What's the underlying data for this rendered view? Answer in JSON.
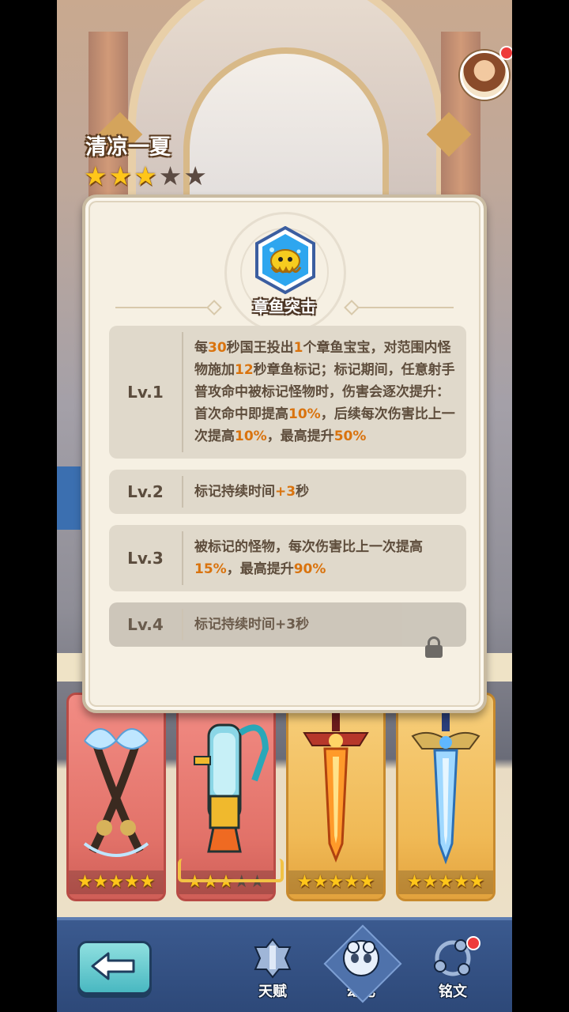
{
  "header": {
    "title": "清凉一夏",
    "stars_filled": 3,
    "stars_total": 5
  },
  "skill": {
    "name": "章鱼突击",
    "icon": "octopus-skill-icon"
  },
  "levels": [
    {
      "label": "Lv.1",
      "parts": [
        {
          "t": "每"
        },
        {
          "t": "30",
          "hl": true
        },
        {
          "t": "秒国王投出"
        },
        {
          "t": "1",
          "hl": true
        },
        {
          "t": "个章鱼宝宝，对范围内怪物施加"
        },
        {
          "t": "12",
          "hl": true
        },
        {
          "t": "秒章鱼标记；标记期间，任意射手普攻命中被标记怪物时，伤害会逐次提升：首次命中即提高"
        },
        {
          "t": "10%",
          "hl": true
        },
        {
          "t": "，后续每次伤害比上一次提高"
        },
        {
          "t": "10%",
          "hl": true
        },
        {
          "t": "，最高提升"
        },
        {
          "t": "50%",
          "hl": true
        }
      ]
    },
    {
      "label": "Lv.2",
      "parts": [
        {
          "t": "标记持续时间"
        },
        {
          "t": "+3",
          "hl": true
        },
        {
          "t": "秒"
        }
      ]
    },
    {
      "label": "Lv.3",
      "parts": [
        {
          "t": "被标记的怪物，每次伤害比上一次提高"
        },
        {
          "t": "15%",
          "hl": true
        },
        {
          "t": "，最高提升"
        },
        {
          "t": "90%",
          "hl": true
        }
      ]
    },
    {
      "label": "Lv.4",
      "locked": true,
      "parts": [
        {
          "t": "标记持续时间+3秒"
        }
      ]
    }
  ],
  "equipment": [
    {
      "name": "dragon-crossed-guns",
      "rarity": "red",
      "stars": 5,
      "selected": false
    },
    {
      "name": "water-gun",
      "rarity": "red",
      "stars": 3,
      "selected": true
    },
    {
      "name": "flame-sword",
      "rarity": "gold",
      "stars": 5,
      "selected": false
    },
    {
      "name": "ice-sword",
      "rarity": "gold",
      "stars": 5,
      "selected": false
    }
  ],
  "nav": {
    "tabs": [
      {
        "label": "天赋",
        "icon": "talent-icon",
        "active": false,
        "badge": false
      },
      {
        "label": "幻化",
        "icon": "transform-icon",
        "active": true,
        "badge": false
      },
      {
        "label": "铭文",
        "icon": "inscription-icon",
        "active": false,
        "badge": true
      }
    ],
    "back_icon": "back-arrow-icon"
  },
  "colors": {
    "highlight": "#d9730e",
    "star": "#ffc61a",
    "nav_bg": "#2d4878",
    "back_button": "#49b8c1",
    "badge": "#ee3b3b"
  }
}
